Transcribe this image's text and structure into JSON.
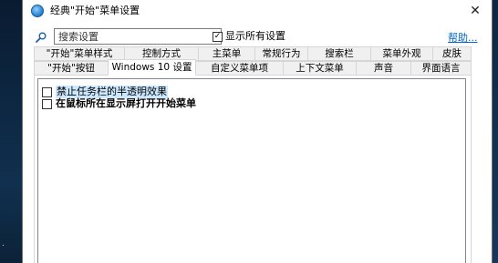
{
  "window": {
    "title": "经典\"开始\"菜单设置"
  },
  "icons": {
    "app": "start-menu-icon",
    "search": "search-icon",
    "close": "close-icon",
    "check": "checkmark"
  },
  "toolbar": {
    "search_placeholder": "搜索设置",
    "show_all_label": "显示所有设置",
    "show_all_checked": true,
    "help_label": "帮助..."
  },
  "tabs": {
    "row1": [
      "\"开始\"菜单样式",
      "控制方式",
      "主菜单",
      "常规行为",
      "搜索栏",
      "菜单外观",
      "皮肤"
    ],
    "row2": [
      "\"开始\"按钮",
      "Windows 10 设置",
      "自定义菜单项",
      "上下文菜单",
      "声音",
      "界面语言"
    ],
    "active": "Windows 10 设置"
  },
  "options": [
    {
      "label": "禁止任务栏的半透明效果",
      "checked": false
    },
    {
      "label": "在鼠标所在显示屏打开开始菜单",
      "checked": false
    }
  ],
  "desktop": {
    "mark": "."
  }
}
